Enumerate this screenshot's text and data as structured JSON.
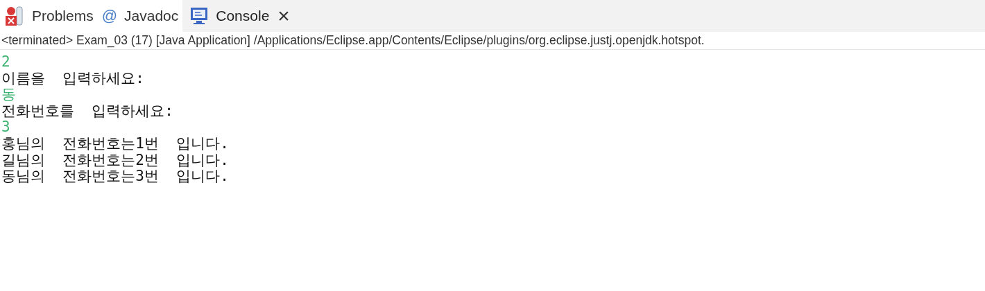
{
  "tabs": [
    {
      "label": "Problems",
      "selected": false
    },
    {
      "label": "Javadoc",
      "glyph": "@",
      "selected": false
    },
    {
      "label": "Console",
      "selected": true
    }
  ],
  "close_glyph": "×",
  "status": "<terminated> Exam_03 (17) [Java Application] /Applications/Eclipse.app/Contents/Eclipse/plugins/org.eclipse.justj.openjdk.hotspot.",
  "lines": [
    {
      "text": "2",
      "kind": "input"
    },
    {
      "text": "이름을  입력하세요:",
      "kind": "output"
    },
    {
      "text": "동",
      "kind": "input"
    },
    {
      "text": "전화번호를  입력하세요:",
      "kind": "output"
    },
    {
      "text": "3",
      "kind": "input"
    },
    {
      "text": "홍님의  전화번호는1번  입니다.",
      "kind": "output"
    },
    {
      "text": "길님의  전화번호는2번  입니다.",
      "kind": "output"
    },
    {
      "text": "동님의  전화번호는3번  입니다.",
      "kind": "output"
    }
  ]
}
